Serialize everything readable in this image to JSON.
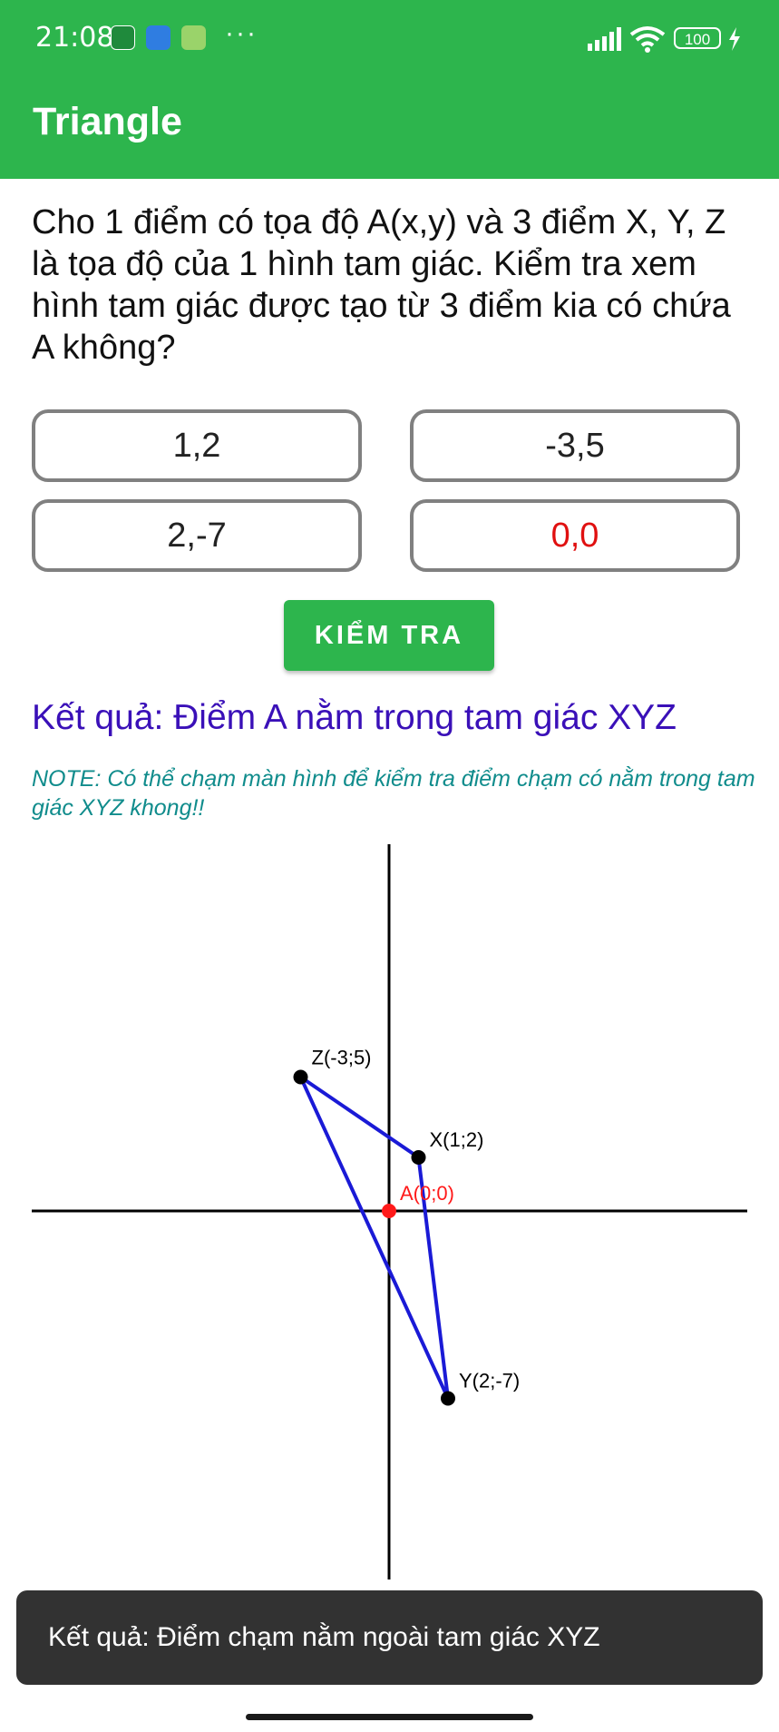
{
  "status_bar": {
    "time": "21:08",
    "more": "···",
    "battery": "100"
  },
  "app_bar": {
    "title": "Triangle"
  },
  "question": "Cho 1 điểm có  tọa độ A(x,y) và 3 điểm X, Y, Z là tọa độ của 1 hình tam giác. Kiểm tra xem hình tam giác được tạo từ 3 điểm kia có chứa A không?",
  "inputs": {
    "x": "1,2",
    "z": "-3,5",
    "y": "2,-7",
    "a": "0,0"
  },
  "button": {
    "label": "KIỂM TRA"
  },
  "result": "Kết quả: Điểm A nằm trong tam giác XYZ",
  "note": "NOTE: Có thể chạm màn hình để kiểm tra điểm chạm có nằm trong tam giác XYZ khong!!",
  "graph": {
    "points": [
      {
        "name": "X",
        "label": "X(1;2)",
        "x": 1,
        "y": 2
      },
      {
        "name": "Y",
        "label": "Y(2;-7)",
        "x": 2,
        "y": -7
      },
      {
        "name": "Z",
        "label": "Z(-3;5)",
        "x": -3,
        "y": 5
      },
      {
        "name": "A",
        "label": "A(0;0)",
        "x": 0,
        "y": 0
      }
    ],
    "colors": {
      "triangle": "#1a1ad6",
      "point": "#000000",
      "a_point": "#ff1a1a",
      "axis": "#000000"
    }
  },
  "toast": "Kết quả: Điểm chạm nằm ngoài tam giác XYZ",
  "colors": {
    "app_bar": "#2db54d",
    "result": "#3a10b8",
    "note": "#108c8c",
    "a_value": "#e01010"
  }
}
